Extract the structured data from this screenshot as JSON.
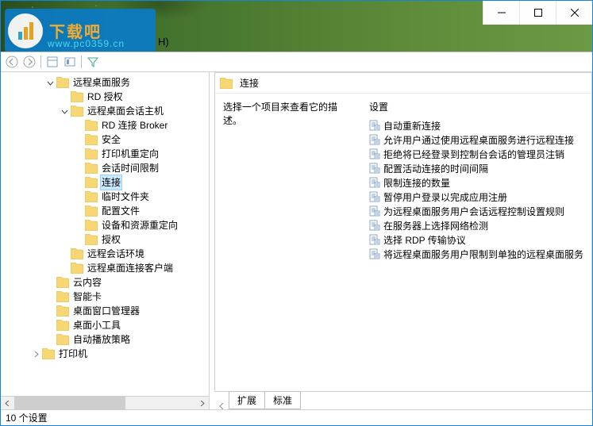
{
  "window": {
    "menu_fragment": "H)"
  },
  "logo": {
    "text": "下载吧",
    "sub": "www.pc0359.cn"
  },
  "tree": {
    "nodes": [
      {
        "depth": 3,
        "expander": "open",
        "label": "远程桌面服务"
      },
      {
        "depth": 4,
        "expander": "none",
        "label": "RD 授权"
      },
      {
        "depth": 4,
        "expander": "open",
        "label": "远程桌面会话主机"
      },
      {
        "depth": 5,
        "expander": "none",
        "label": "RD 连接 Broker"
      },
      {
        "depth": 5,
        "expander": "none",
        "label": "安全"
      },
      {
        "depth": 5,
        "expander": "none",
        "label": "打印机重定向"
      },
      {
        "depth": 5,
        "expander": "none",
        "label": "会话时间限制"
      },
      {
        "depth": 5,
        "expander": "none",
        "label": "连接",
        "selected": true
      },
      {
        "depth": 5,
        "expander": "none",
        "label": "临时文件夹"
      },
      {
        "depth": 5,
        "expander": "none",
        "label": "配置文件"
      },
      {
        "depth": 5,
        "expander": "none",
        "label": "设备和资源重定向"
      },
      {
        "depth": 5,
        "expander": "none",
        "label": "授权"
      },
      {
        "depth": 4,
        "expander": "none",
        "label": "远程会话环境"
      },
      {
        "depth": 4,
        "expander": "none",
        "label": "远程桌面连接客户端"
      },
      {
        "depth": 3,
        "expander": "none",
        "label": "云内容"
      },
      {
        "depth": 3,
        "expander": "none",
        "label": "智能卡"
      },
      {
        "depth": 3,
        "expander": "none",
        "label": "桌面窗口管理器"
      },
      {
        "depth": 3,
        "expander": "none",
        "label": "桌面小工具"
      },
      {
        "depth": 3,
        "expander": "none",
        "label": "自动播放策略"
      },
      {
        "depth": 2,
        "expander": "closed",
        "label": "打印机"
      }
    ]
  },
  "content": {
    "header": "连接",
    "description": "选择一个项目来查看它的描述。",
    "settings_heading": "设置",
    "settings": [
      "自动重新连接",
      "允许用户通过使用远程桌面服务进行远程连接",
      "拒绝将已经登录到控制台会话的管理员注销",
      "配置活动连接的时间间隔",
      "限制连接的数量",
      "暂停用户登录以完成应用注册",
      "为远程桌面服务用户会话远程控制设置规则",
      "在服务器上选择网络检测",
      "选择 RDP 传输协议",
      "将远程桌面服务用户限制到单独的远程桌面服务"
    ]
  },
  "tabs": {
    "items": [
      "扩展",
      "标准"
    ],
    "active": 0
  },
  "status": "10 个设置",
  "icons": {
    "minimize": "minimize-icon",
    "maximize": "maximize-icon",
    "close": "close-icon"
  }
}
